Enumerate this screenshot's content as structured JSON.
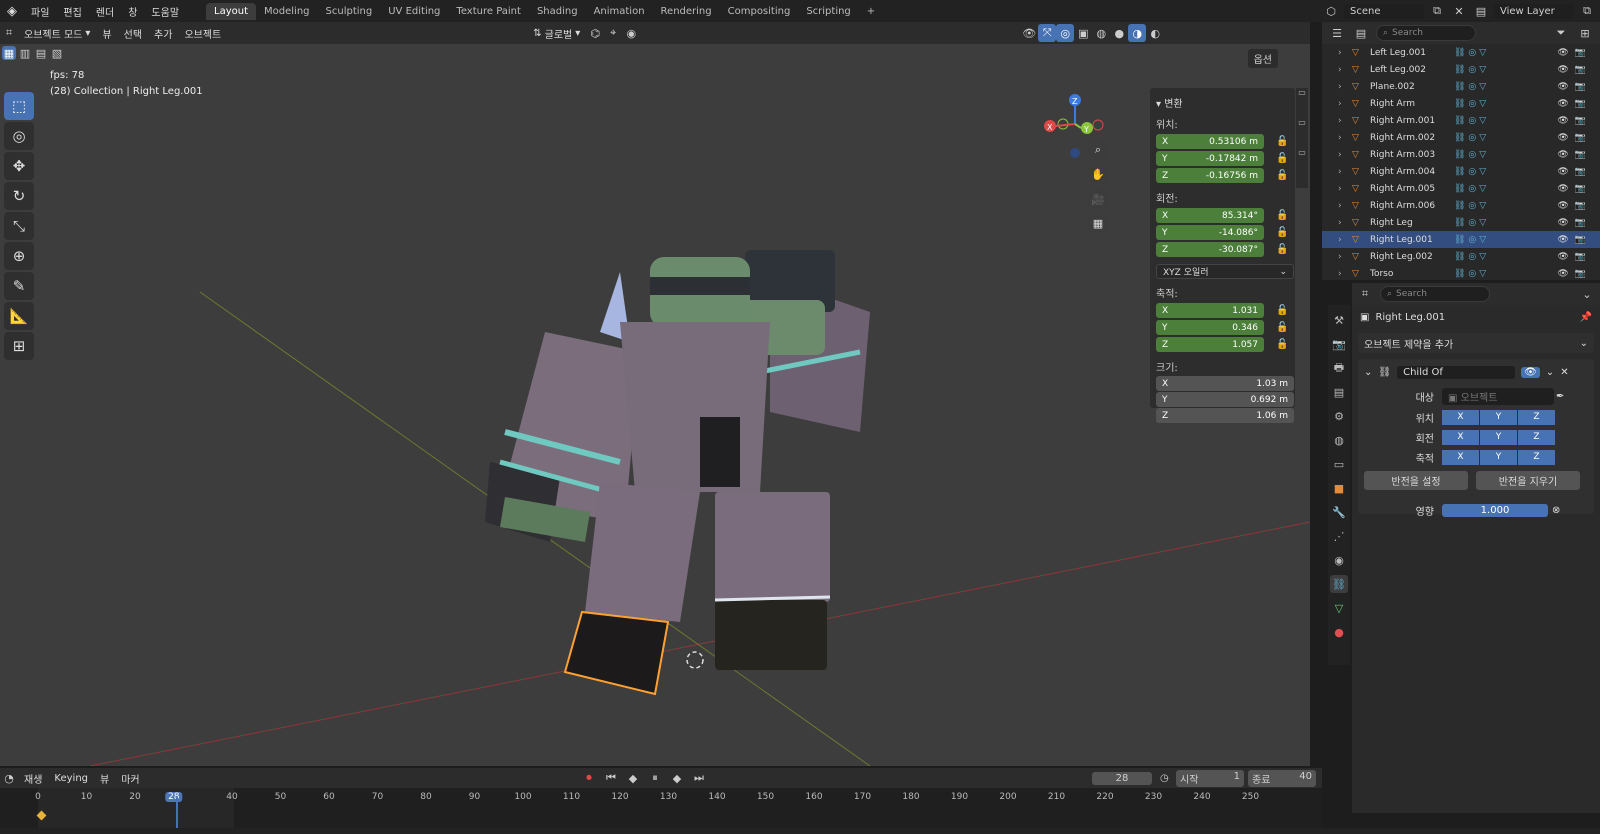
{
  "topbar": {
    "menus": [
      "파일",
      "편집",
      "렌더",
      "창",
      "도움말"
    ],
    "workspaces": [
      "Layout",
      "Modeling",
      "Sculpting",
      "UV Editing",
      "Texture Paint",
      "Shading",
      "Animation",
      "Rendering",
      "Compositing",
      "Scripting"
    ],
    "active_workspace": "Layout",
    "scene": "Scene",
    "view_layer": "View Layer"
  },
  "viewport_header": {
    "mode": "오브젝트 모드",
    "menus": [
      "뷰",
      "선택",
      "추가",
      "오브젝트"
    ],
    "orientation": "글로벌",
    "options": "옵션"
  },
  "overlay": {
    "fps": "fps: 78",
    "info": "(28) Collection | Right Leg.001"
  },
  "gizmo": {
    "z": "Z",
    "y": "Y",
    "x": "X"
  },
  "npanel": {
    "section": "변환",
    "location_label": "위치:",
    "location": [
      "0.53106 m",
      "-0.17842 m",
      "-0.16756 m"
    ],
    "rotation_label": "회전:",
    "rotation": [
      "85.314°",
      "-14.086°",
      "-30.087°"
    ],
    "rotation_mode": "XYZ 오일러",
    "scale_label": "축적:",
    "scale": [
      "1.031",
      "0.346",
      "1.057"
    ],
    "dimensions_label": "크기:",
    "dimensions": [
      "1.03 m",
      "0.692 m",
      "1.06 m"
    ],
    "axes": [
      "X",
      "Y",
      "Z"
    ]
  },
  "outliner": {
    "search_placeholder": "Search",
    "items": [
      {
        "name": "Left Leg.001",
        "selected": false
      },
      {
        "name": "Left Leg.002",
        "selected": false
      },
      {
        "name": "Plane.002",
        "selected": false
      },
      {
        "name": "Right Arm",
        "selected": false
      },
      {
        "name": "Right Arm.001",
        "selected": false
      },
      {
        "name": "Right Arm.002",
        "selected": false
      },
      {
        "name": "Right Arm.003",
        "selected": false
      },
      {
        "name": "Right Arm.004",
        "selected": false
      },
      {
        "name": "Right Arm.005",
        "selected": false
      },
      {
        "name": "Right Arm.006",
        "selected": false
      },
      {
        "name": "Right Leg",
        "selected": false
      },
      {
        "name": "Right Leg.001",
        "selected": true
      },
      {
        "name": "Right Leg.002",
        "selected": false
      },
      {
        "name": "Torso",
        "selected": false
      }
    ]
  },
  "properties": {
    "search_placeholder": "Search",
    "object_name": "Right Leg.001",
    "add_constraint": "오브젝트 제약을 추가",
    "constraint_name": "Child Of",
    "target_label": "대상",
    "target_placeholder": "오브젝트",
    "location_label": "위치",
    "rotation_label": "회전",
    "scale_label": "축적",
    "axes": [
      "X",
      "Y",
      "Z"
    ],
    "set_inverse": "반전을 설정",
    "clear_inverse": "반전을 지우기",
    "influence_label": "영향",
    "influence": "1.000"
  },
  "timeline": {
    "playback": "재생",
    "keying": "Keying",
    "view": "뷰",
    "marker": "마커",
    "current_frame": "28",
    "start_label": "시작",
    "start": "1",
    "end_label": "종료",
    "end": "40",
    "ruler": [
      "0",
      "10",
      "20",
      "28",
      "40",
      "50",
      "60",
      "70",
      "80",
      "90",
      "100",
      "110",
      "120",
      "130",
      "140",
      "150",
      "160",
      "170",
      "180",
      "190",
      "200",
      "210",
      "220",
      "230",
      "240",
      "250"
    ]
  },
  "colors": {
    "accent": "#4772b3",
    "selection": "#ffa033",
    "green_field": "#4c7f3a"
  }
}
